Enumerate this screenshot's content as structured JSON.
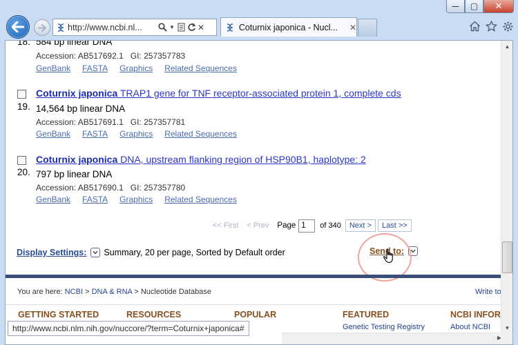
{
  "browser": {
    "address": "http://www.ncbi.nl...",
    "tab_title": "Coturnix japonica - Nucl...",
    "tab_close": "✕",
    "status_url": "http://www.ncbi.nlm.nih.gov/nuccore/?term=Coturnix+japonica#",
    "window_controls": {
      "minimize": "—",
      "maximize": "▢",
      "close": "✕"
    }
  },
  "results": [
    {
      "number": "18.",
      "title_bold": "",
      "title_rest": "",
      "size": "584 bp linear DNA",
      "accession": "Accession: AB517692.1",
      "gi": "GI: 257357783",
      "links": [
        "GenBank",
        "FASTA",
        "Graphics",
        "Related Sequences"
      ]
    },
    {
      "number": "19.",
      "title_bold": "Coturnix japonica",
      "title_rest": " TRAP1 gene for TNF receptor-associated protein 1, complete cds",
      "size": "14,564 bp linear DNA",
      "accession": "Accession: AB517691.1",
      "gi": "GI: 257357781",
      "links": [
        "GenBank",
        "FASTA",
        "Graphics",
        "Related Sequences"
      ]
    },
    {
      "number": "20.",
      "title_bold": "Coturnix japonica",
      "title_rest": " DNA, upstream flanking region of HSP90B1, haplotype: 2",
      "size": "797 bp linear DNA",
      "accession": "Accession: AB517690.1",
      "gi": "GI: 257357780",
      "links": [
        "GenBank",
        "FASTA",
        "Graphics",
        "Related Sequences"
      ]
    }
  ],
  "pager": {
    "first": "<< First",
    "prev": "< Prev",
    "page_label": "Page",
    "page_value": "1",
    "of_total": "of 340",
    "next": "Next >",
    "last": "Last >>"
  },
  "display": {
    "settings_label": "Display Settings:",
    "summary": "Summary, 20 per page, Sorted by Default order",
    "send_to": "Send to:"
  },
  "footer": {
    "you_are_here": "You are here:",
    "crumbs": [
      "NCBI",
      "DNA & RNA",
      "Nucleotide Database"
    ],
    "sep": ">",
    "write_to": "Write to",
    "headings": [
      "GETTING STARTED",
      "RESOURCES",
      "POPULAR",
      "FEATURED",
      "NCBI INFORM"
    ],
    "sub_featured": "Genetic Testing Registry",
    "sub_ncbi": "About NCBI"
  }
}
